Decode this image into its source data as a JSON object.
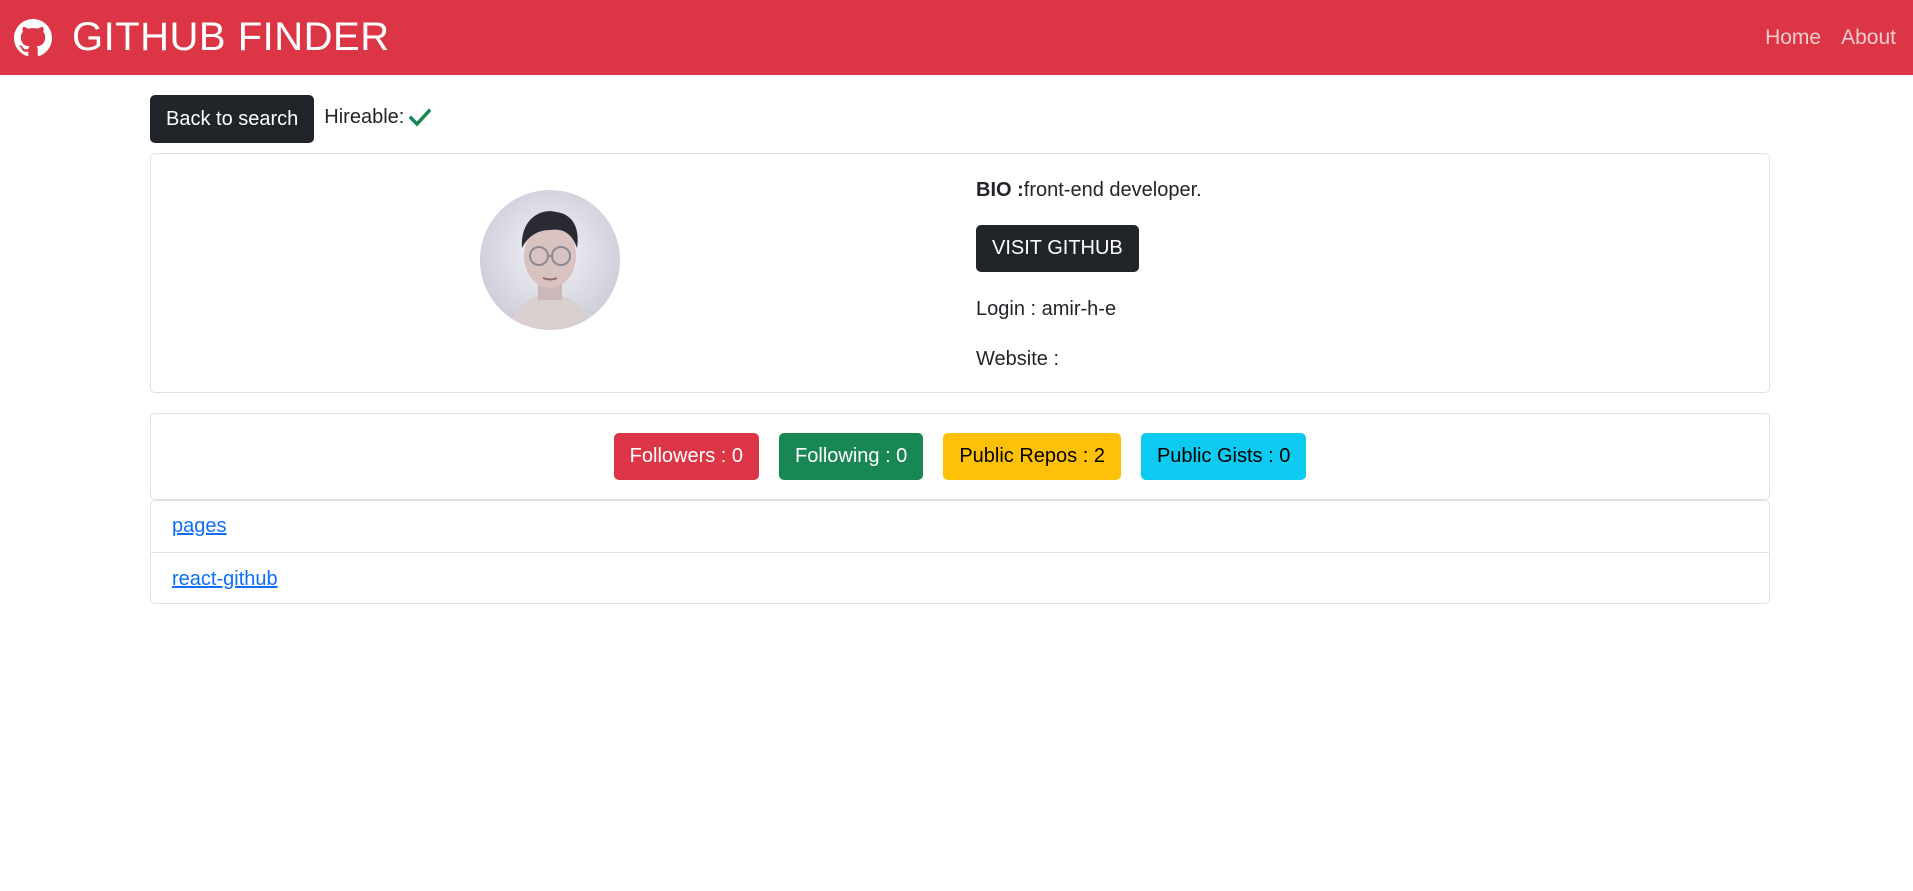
{
  "navbar": {
    "brand_icon": "github-icon",
    "brand": "GITHUB FINDER",
    "links": [
      {
        "label": "Home"
      },
      {
        "label": "About"
      }
    ],
    "color": "#dc3545"
  },
  "topbar": {
    "back_label": "Back to search",
    "hireable_label": "Hireable:",
    "hireable_icon": "check-icon",
    "hireable": true
  },
  "profile": {
    "avatar": "avatar-photo",
    "bio_label": "BIO :",
    "bio": "front-end developer.",
    "visit_label": "VISIT GITHUB",
    "login_label": "Login : ",
    "login": "amir-h-e",
    "website_label": "Website :",
    "website": ""
  },
  "stats": {
    "followers": "Followers : 0",
    "following": "Following : 0",
    "public_repos": "Public Repos : 2",
    "public_gists": "Public Gists : 0"
  },
  "repos": [
    {
      "name": "pages"
    },
    {
      "name": "react-github"
    }
  ]
}
